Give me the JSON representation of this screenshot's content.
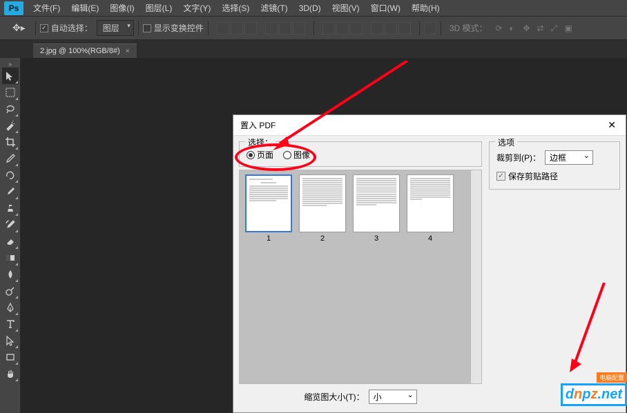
{
  "app": {
    "logo": "Ps"
  },
  "menu": {
    "items": [
      "文件(F)",
      "编辑(E)",
      "图像(I)",
      "图层(L)",
      "文字(Y)",
      "选择(S)",
      "滤镜(T)",
      "3D(D)",
      "视图(V)",
      "窗口(W)",
      "帮助(H)"
    ]
  },
  "options": {
    "auto_select": "自动选择：",
    "auto_select_value": "图层",
    "show_transform": "显示变换控件",
    "mode_3d": "3D 模式："
  },
  "tabs": [
    {
      "title": "2.jpg @ 100%(RGB/8#)"
    }
  ],
  "dialog": {
    "title": "置入 PDF",
    "select_label": "选择：",
    "radio_page": "页面",
    "radio_image": "图像",
    "thumbs": [
      "1",
      "2",
      "3",
      "4"
    ],
    "thumb_size_label": "缩览图大小(T)：",
    "thumb_size_value": "小",
    "options_label": "选项",
    "crop_label": "裁剪到(P)：",
    "crop_value": "边框",
    "preserve_clip": "保存剪贴路径"
  },
  "watermark": {
    "badge": "电脑配置",
    "text_pre": "d",
    "text_mid": "n",
    "text_p": "p",
    "text_z": "z",
    "text_net": ".net"
  }
}
